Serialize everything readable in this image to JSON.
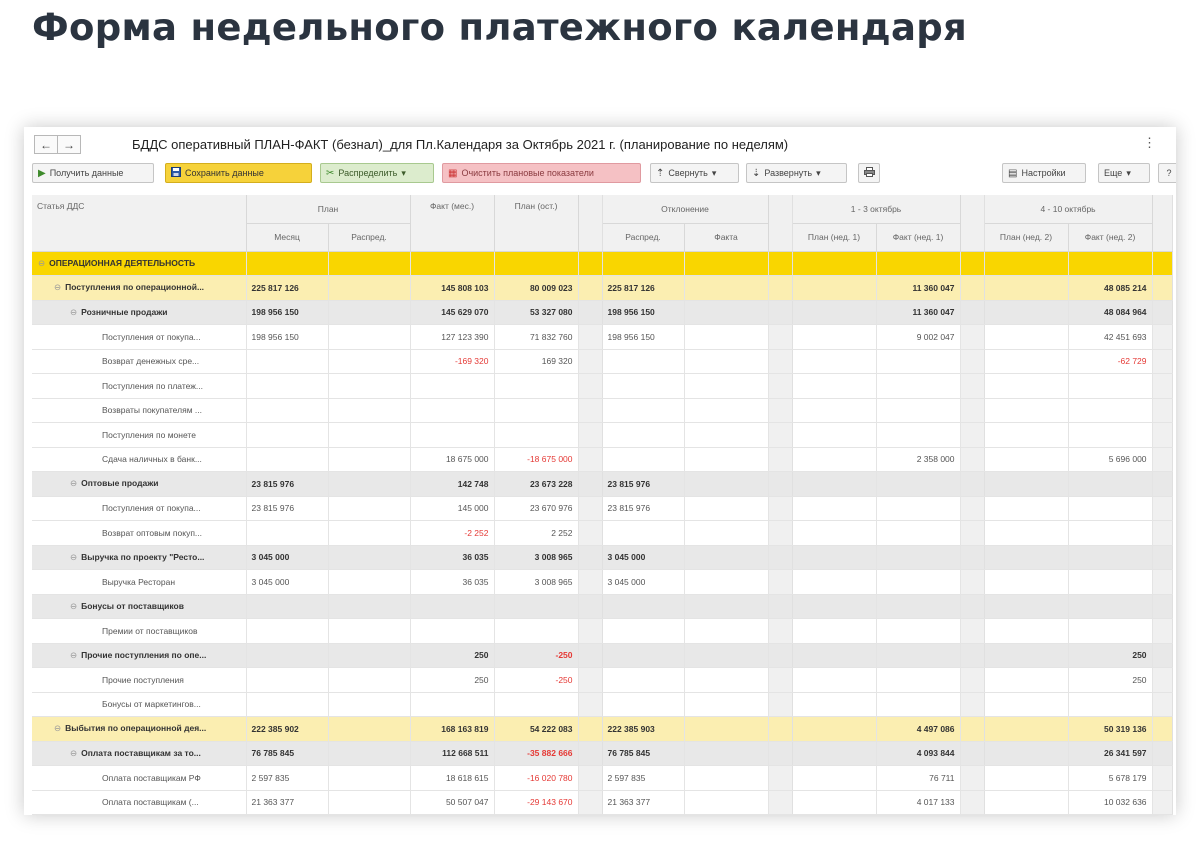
{
  "page_title": "Форма недельного платежного календаря",
  "window": {
    "back_label": "←",
    "forward_label": "→",
    "title": "БДДС оперативный ПЛАН-ФАКТ (безнал)_для Пл.Календаря  за Октябрь 2021 г. (планирование по неделям)",
    "more_label": "⋮"
  },
  "toolbar": {
    "get_data": "Получить данные",
    "save_data": "Сохранить данные",
    "distribute": "Распределить",
    "clear_plan": "Очистить плановые показатели",
    "collapse": "Свернуть",
    "expand": "Развернуть",
    "settings": "Настройки",
    "more": "Еще"
  },
  "icons": {
    "get_data": "play-icon",
    "save_data": "save-disk-icon",
    "distribute": "distribute-icon",
    "clear_plan": "clear-icon",
    "collapse": "collapse-icon",
    "expand": "expand-icon",
    "print": "print-icon",
    "settings": "settings-icon",
    "tree_toggle": "collapse-minus-icon"
  },
  "colors": {
    "section_highlight": "#f9d600",
    "group_highlight": "#fbeeb1",
    "subgroup_highlight": "#e8e8e8",
    "negative_value": "#e53935",
    "save_button": "#f6d23a"
  },
  "table": {
    "header": {
      "article": "Статья ДДС",
      "plan": "План",
      "fact_month": "Факт (мес.)",
      "plan_rest": "План (ост.)",
      "deviation": "Отклонение",
      "week1": "1 - 3 октябрь",
      "week2": "4 - 10 октябрь",
      "month": "Месяц",
      "distributed": "Распред.",
      "dev_distributed": "Распред.",
      "dev_fact": "Факта",
      "plan_w1": "План (нед. 1)",
      "fact_w1": "Факт (нед. 1)",
      "plan_w2": "План (нед. 2)",
      "fact_w2": "Факт (нед. 2)"
    },
    "rows": [
      {
        "level": 0,
        "name": "ОПЕРАЦИОННАЯ ДЕЯТЕЛЬНОСТЬ",
        "month": "",
        "fact": "",
        "rest": "",
        "dev": "",
        "fact_w1": "",
        "fact_w2": ""
      },
      {
        "level": 1,
        "name": "Поступления по операционной...",
        "month": "225 817 126",
        "fact": "145 808 103",
        "rest": "80 009 023",
        "dev": "225 817 126",
        "fact_w1": "11 360 047",
        "fact_w2": "48 085 214"
      },
      {
        "level": 2,
        "name": "Розничные продажи",
        "month": "198 956 150",
        "fact": "145 629 070",
        "rest": "53 327 080",
        "dev": "198 956 150",
        "fact_w1": "11 360 047",
        "fact_w2": "48 084 964"
      },
      {
        "level": 3,
        "name": "Поступления от покупа...",
        "month": "198 956 150",
        "fact": "127 123 390",
        "rest": "71 832 760",
        "dev": "198 956 150",
        "fact_w1": "9 002 047",
        "fact_w2": "42 451 693"
      },
      {
        "level": 3,
        "name": "Возврат денежных сре...",
        "month": "",
        "fact": "-169 320",
        "rest": "169 320",
        "dev": "",
        "fact_w1": "",
        "fact_w2": "-62 729"
      },
      {
        "level": 3,
        "name": "Поступления по платеж...",
        "month": "",
        "fact": "",
        "rest": "",
        "dev": "",
        "fact_w1": "",
        "fact_w2": ""
      },
      {
        "level": 3,
        "name": "Возвраты покупателям ...",
        "month": "",
        "fact": "",
        "rest": "",
        "dev": "",
        "fact_w1": "",
        "fact_w2": ""
      },
      {
        "level": 3,
        "name": "Поступления по монете",
        "month": "",
        "fact": "",
        "rest": "",
        "dev": "",
        "fact_w1": "",
        "fact_w2": ""
      },
      {
        "level": 3,
        "name": "Сдача наличных в банк...",
        "month": "",
        "fact": "18 675 000",
        "rest": "-18 675 000",
        "dev": "",
        "fact_w1": "2 358 000",
        "fact_w2": "5 696 000"
      },
      {
        "level": 2,
        "name": "Оптовые продажи",
        "month": "23 815 976",
        "fact": "142 748",
        "rest": "23 673 228",
        "dev": "23 815 976",
        "fact_w1": "",
        "fact_w2": ""
      },
      {
        "level": 3,
        "name": "Поступления от покупа...",
        "month": "23 815 976",
        "fact": "145 000",
        "rest": "23 670 976",
        "dev": "23 815 976",
        "fact_w1": "",
        "fact_w2": ""
      },
      {
        "level": 3,
        "name": "Возврат оптовым покуп...",
        "month": "",
        "fact": "-2 252",
        "rest": "2 252",
        "dev": "",
        "fact_w1": "",
        "fact_w2": ""
      },
      {
        "level": 2,
        "name": "Выручка по проекту \"Ресто...",
        "month": "3 045 000",
        "fact": "36 035",
        "rest": "3 008 965",
        "dev": "3 045 000",
        "fact_w1": "",
        "fact_w2": ""
      },
      {
        "level": 3,
        "name": "Выручка Ресторан",
        "month": "3 045 000",
        "fact": "36 035",
        "rest": "3 008 965",
        "dev": "3 045 000",
        "fact_w1": "",
        "fact_w2": ""
      },
      {
        "level": 2,
        "name": "Бонусы от поставщиков",
        "month": "",
        "fact": "",
        "rest": "",
        "dev": "",
        "fact_w1": "",
        "fact_w2": ""
      },
      {
        "level": 3,
        "name": "Премии от поставщиков",
        "month": "",
        "fact": "",
        "rest": "",
        "dev": "",
        "fact_w1": "",
        "fact_w2": ""
      },
      {
        "level": 2,
        "name": "Прочие поступления по опе...",
        "month": "",
        "fact": "250",
        "rest": "-250",
        "dev": "",
        "fact_w1": "",
        "fact_w2": "250"
      },
      {
        "level": 3,
        "name": "Прочие поступления",
        "month": "",
        "fact": "250",
        "rest": "-250",
        "dev": "",
        "fact_w1": "",
        "fact_w2": "250"
      },
      {
        "level": 3,
        "name": "Бонусы от маркетингов...",
        "month": "",
        "fact": "",
        "rest": "",
        "dev": "",
        "fact_w1": "",
        "fact_w2": ""
      },
      {
        "level": 1,
        "name": "Выбытия по операционной дея...",
        "month": "222 385 902",
        "fact": "168 163 819",
        "rest": "54 222 083",
        "dev": "222 385 903",
        "fact_w1": "4 497 086",
        "fact_w2": "50 319 136"
      },
      {
        "level": 2,
        "name": "Оплата поставщикам за то...",
        "month": "76 785 845",
        "fact": "112 668 511",
        "rest": "-35 882 666",
        "dev": "76 785 845",
        "fact_w1": "4 093 844",
        "fact_w2": "26 341 597"
      },
      {
        "level": 3,
        "name": "Оплата поставщикам РФ",
        "month": "2 597 835",
        "fact": "18 618 615",
        "rest": "-16 020 780",
        "dev": "2 597 835",
        "fact_w1": "76 711",
        "fact_w2": "5 678 179"
      },
      {
        "level": 3,
        "name": "Оплата поставщикам (...",
        "month": "21 363 377",
        "fact": "50 507 047",
        "rest": "-29 143 670",
        "dev": "21 363 377",
        "fact_w1": "4 017 133",
        "fact_w2": "10 032 636"
      }
    ]
  }
}
